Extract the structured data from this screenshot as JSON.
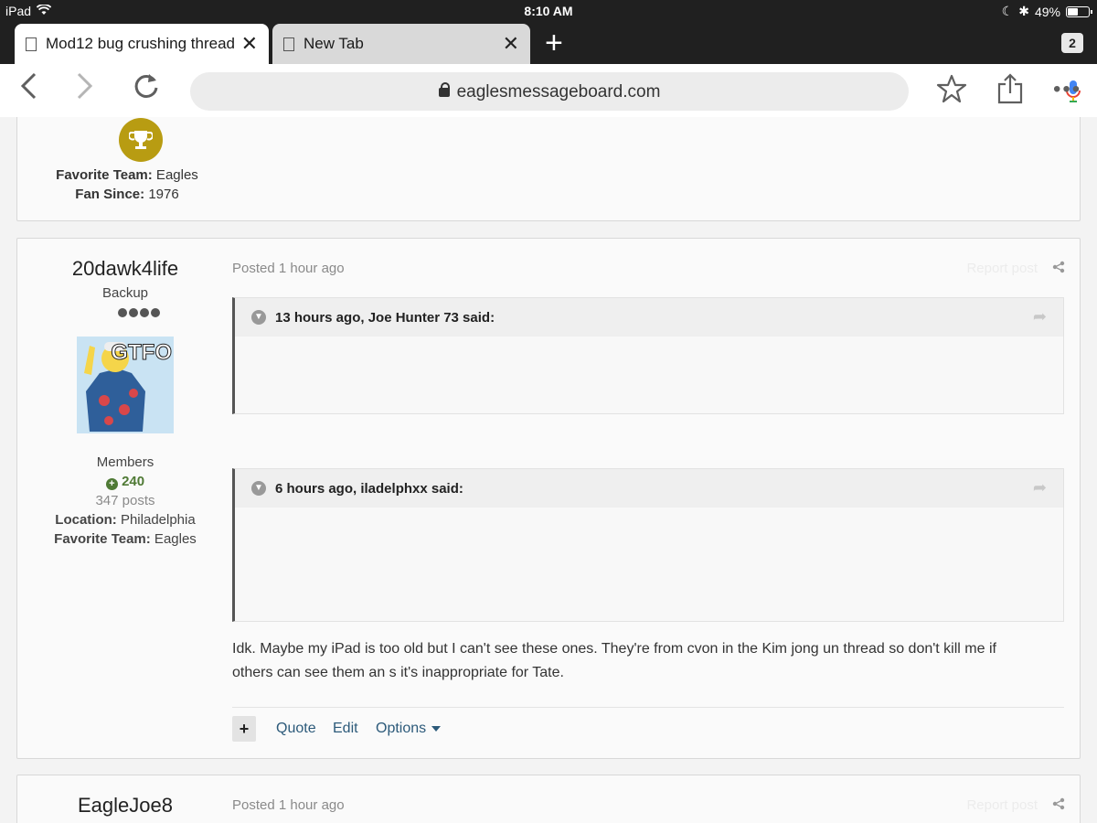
{
  "status_bar": {
    "device": "iPad",
    "time": "8:10 AM",
    "battery": "49%",
    "battery_level": 0.49
  },
  "tabs": [
    {
      "title": "Mod12 bug crushing thread",
      "active": true
    },
    {
      "title": "New Tab",
      "active": false
    }
  ],
  "tab_count": "2",
  "address_bar": {
    "url": "eaglesmessageboard.com"
  },
  "prev_post_profile": {
    "favorite_team_label": "Favorite Team:",
    "favorite_team": " Eagles",
    "fan_since_label": "Fan Since:",
    "fan_since": " 1976"
  },
  "post1": {
    "username": "20dawk4life",
    "rank": "Backup",
    "group": "Members",
    "reputation": "240",
    "posts": "347 posts",
    "location_label": "Location:",
    "location": " Philadelphia",
    "favorite_team_label": "Favorite Team:",
    "favorite_team": " Eagles",
    "avatar_text": "GTFO",
    "posted": "Posted 1 hour ago",
    "report": "Report post",
    "quotes": [
      {
        "header": "13 hours ago, Joe Hunter 73 said:"
      },
      {
        "header": "6 hours ago, iladelphxx said:"
      }
    ],
    "body": "Idk. Maybe my iPad is too old but I can't see these ones. They're from cvon in the Kim jong un thread so don't kill me if others can see them an s it's inappropriate for Tate.",
    "actions": {
      "plus": "+",
      "quote": "Quote",
      "edit": "Edit",
      "options": "Options"
    }
  },
  "post2": {
    "username": "EagleJoe8",
    "posted": "Posted 1 hour ago",
    "report": "Report post"
  }
}
